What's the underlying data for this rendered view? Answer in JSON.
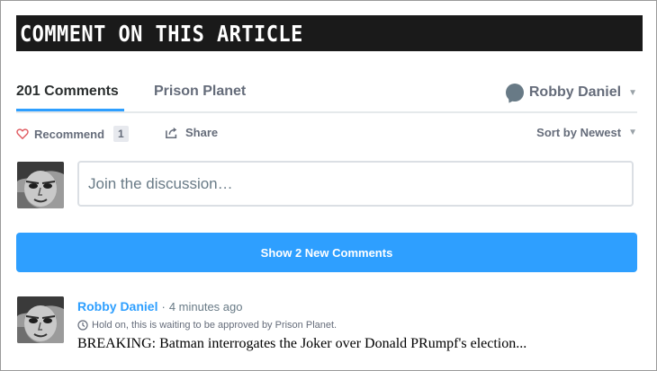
{
  "header": {
    "title": "COMMENT ON THIS ARTICLE"
  },
  "nav": {
    "tabs": [
      {
        "label": "201 Comments",
        "active": true
      },
      {
        "label": "Prison Planet",
        "active": false
      }
    ],
    "user": {
      "name": "Robby Daniel"
    }
  },
  "actions": {
    "recommend_label": "Recommend",
    "recommend_count": "1",
    "share_label": "Share",
    "sort_label": "Sort by Newest"
  },
  "composer": {
    "placeholder": "Join the discussion…"
  },
  "new_comments": {
    "label": "Show 2 New Comments"
  },
  "comment": {
    "author": "Robby Daniel",
    "separator": "·",
    "time": "4 minutes ago",
    "pending_notice": "Hold on, this is waiting to be approved by Prison Planet.",
    "body": "BREAKING: Batman interrogates the Joker over Donald PRumpf's election..."
  },
  "colors": {
    "accent": "#2e9fff",
    "title_bar": "#1a1a1a",
    "muted_text": "#656c7a",
    "heart": "#e0595f"
  },
  "icons": {
    "recommend": "heart-outline-icon",
    "share": "share-icon",
    "user_menu": "speech-bubble-icon",
    "pending": "clock-icon"
  }
}
